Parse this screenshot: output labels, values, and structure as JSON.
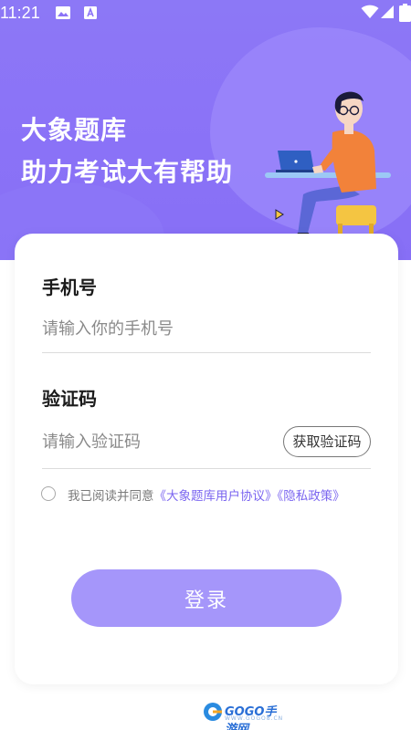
{
  "status_bar": {
    "time": "11:21",
    "icons": [
      "image-icon",
      "a-notification-icon",
      "wifi-icon",
      "cellular-icon",
      "battery-icon"
    ]
  },
  "hero": {
    "line1": "大象题库",
    "line2": "助力考试大有帮助",
    "background_color": "#8B73F7"
  },
  "form": {
    "phone_label": "手机号",
    "phone_placeholder": "请输入你的手机号",
    "phone_value": "",
    "code_label": "验证码",
    "code_placeholder": "请输入验证码",
    "code_value": "",
    "get_code_label": "获取验证码"
  },
  "agreement": {
    "checked": false,
    "prefix": "我已阅读并同意",
    "user_agreement": "《大象题库用户协议》",
    "privacy_policy": "《隐私政策》",
    "link_color": "#7B66F0"
  },
  "login": {
    "label": "登录",
    "button_color": "#A596FA"
  },
  "watermark": {
    "text": "GOGO手游网",
    "sub": "WWW.GOGO8.CN"
  }
}
